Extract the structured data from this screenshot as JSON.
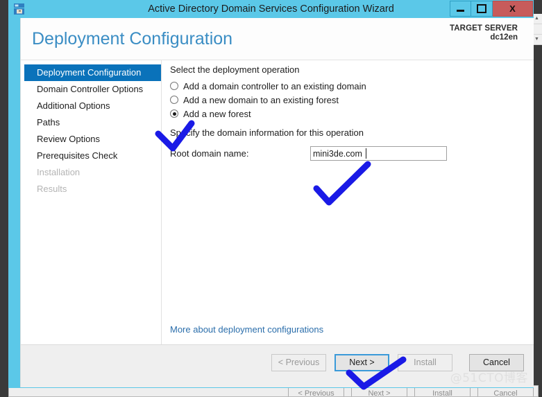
{
  "window": {
    "title": "Active Directory Domain Services Configuration Wizard",
    "icon": "server-manager-icon",
    "minimize_label": "",
    "maximize_label": "",
    "close_label": "X",
    "frame_color": "#5bc8e8"
  },
  "header": {
    "page_title": "Deployment Configuration",
    "target_server_label": "TARGET SERVER",
    "target_server_name": "dc12en",
    "title_color": "#3a8dc4"
  },
  "sidebar": {
    "items": [
      {
        "label": "Deployment Configuration",
        "state": "selected"
      },
      {
        "label": "Domain Controller Options",
        "state": "enabled"
      },
      {
        "label": "Additional Options",
        "state": "enabled"
      },
      {
        "label": "Paths",
        "state": "enabled"
      },
      {
        "label": "Review Options",
        "state": "enabled"
      },
      {
        "label": "Prerequisites Check",
        "state": "enabled"
      },
      {
        "label": "Installation",
        "state": "disabled"
      },
      {
        "label": "Results",
        "state": "disabled"
      }
    ],
    "selected_bg": "#0a72ba"
  },
  "main": {
    "operation_section_label": "Select the deployment operation",
    "operations": [
      {
        "label": "Add a domain controller to an existing domain",
        "checked": false
      },
      {
        "label": "Add a new domain to an existing forest",
        "checked": false
      },
      {
        "label": "Add a new forest",
        "checked": true
      }
    ],
    "domain_section_label": "Specify the domain information for this operation",
    "root_domain_label": "Root domain name:",
    "root_domain_value": "mini3de.com",
    "root_domain_placeholder": "",
    "more_link": "More about deployment configurations"
  },
  "footer": {
    "buttons": [
      {
        "label": "< Previous",
        "state": "disabled"
      },
      {
        "label": "Next >",
        "state": "focused"
      },
      {
        "label": "Install",
        "state": "disabled"
      },
      {
        "label": "Cancel",
        "state": "enabled"
      }
    ],
    "watermark": "@51CTO博客"
  },
  "annotations": {
    "color": "#1a1ae6",
    "marks": [
      "checkmark-over-new-forest-radio",
      "checkmark-under-root-domain-input",
      "checkmark-over-next-button"
    ]
  }
}
